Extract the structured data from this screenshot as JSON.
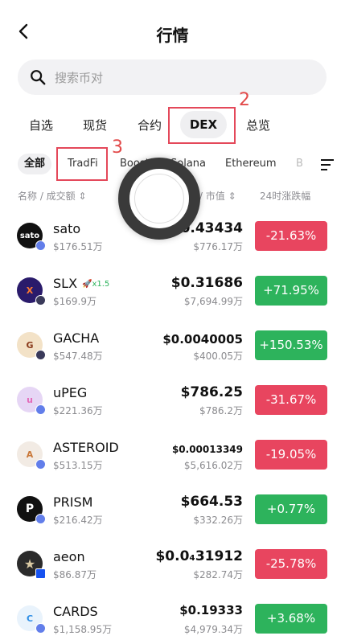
{
  "header": {
    "title": "行情"
  },
  "search": {
    "placeholder": "搜索币对"
  },
  "tabs": [
    "自选",
    "现货",
    "合约",
    "DEX",
    "总览"
  ],
  "markers": {
    "dex_marker": "2",
    "tradfi_marker": "3"
  },
  "chips": [
    "全部",
    "TradFi",
    "Boost",
    "Solana",
    "Ethereum",
    "B"
  ],
  "columns": {
    "name_vol": "名称 / 成交额",
    "price_mcap": "/ 市值",
    "change": "24时涨跌幅"
  },
  "rows": [
    {
      "name": "sato",
      "vol": "$176.51万",
      "price": "$0.43434",
      "mcap": "$776.17万",
      "change": "-21.63%",
      "dir": "neg",
      "avatar_text": "sato",
      "avatar_color": "#111111",
      "chain_color": "#627eea"
    },
    {
      "name": "SLX",
      "tag": "x1.5",
      "vol": "$169.9万",
      "price": "$0.31686",
      "mcap": "$7,694.99万",
      "change": "+71.95%",
      "dir": "pos",
      "avatar_text": "X",
      "avatar_color": "#2a1b6b",
      "chain_color": "#3a3a5a"
    },
    {
      "name": "GACHA",
      "vol": "$547.48万",
      "price": "$0.0040005",
      "mcap": "$400.05万",
      "change": "+150.53%",
      "dir": "pos",
      "avatar_text": "G",
      "avatar_color": "#d9b37a",
      "chain_color": "#3a3a5a"
    },
    {
      "name": "uPEG",
      "vol": "$221.36万",
      "price": "$786.25",
      "mcap": "$786.2万",
      "change": "-31.67%",
      "dir": "neg",
      "avatar_text": "u",
      "avatar_color": "#e36ab9",
      "chain_color": "#627eea"
    },
    {
      "name": "ASTEROID",
      "vol": "$513.15万",
      "price": "$0.00013349",
      "mcap": "$5,616.02万",
      "change": "-19.05%",
      "dir": "neg",
      "avatar_text": "A",
      "avatar_color": "#e7a66c",
      "chain_color": "#627eea"
    },
    {
      "name": "PRISM",
      "vol": "$216.42万",
      "price": "$664.53",
      "mcap": "$332.26万",
      "change": "+0.77%",
      "dir": "pos",
      "avatar_text": "P",
      "avatar_color": "#111111",
      "chain_color": "#627eea"
    },
    {
      "name": "aeon",
      "vol": "$86.87万",
      "price": "$0.0₄31912",
      "mcap": "$282.74万",
      "change": "-25.78%",
      "dir": "neg",
      "avatar_text": "★",
      "avatar_color": "#2b2b2b",
      "chain_color": "#1652f0"
    },
    {
      "name": "CARDS",
      "vol": "$1,158.95万",
      "price": "$0.19333",
      "mcap": "$4,979.34万",
      "change": "+3.68%",
      "dir": "pos",
      "avatar_text": "C",
      "avatar_color": "#2d8ee6",
      "chain_color": "#627eea"
    }
  ]
}
